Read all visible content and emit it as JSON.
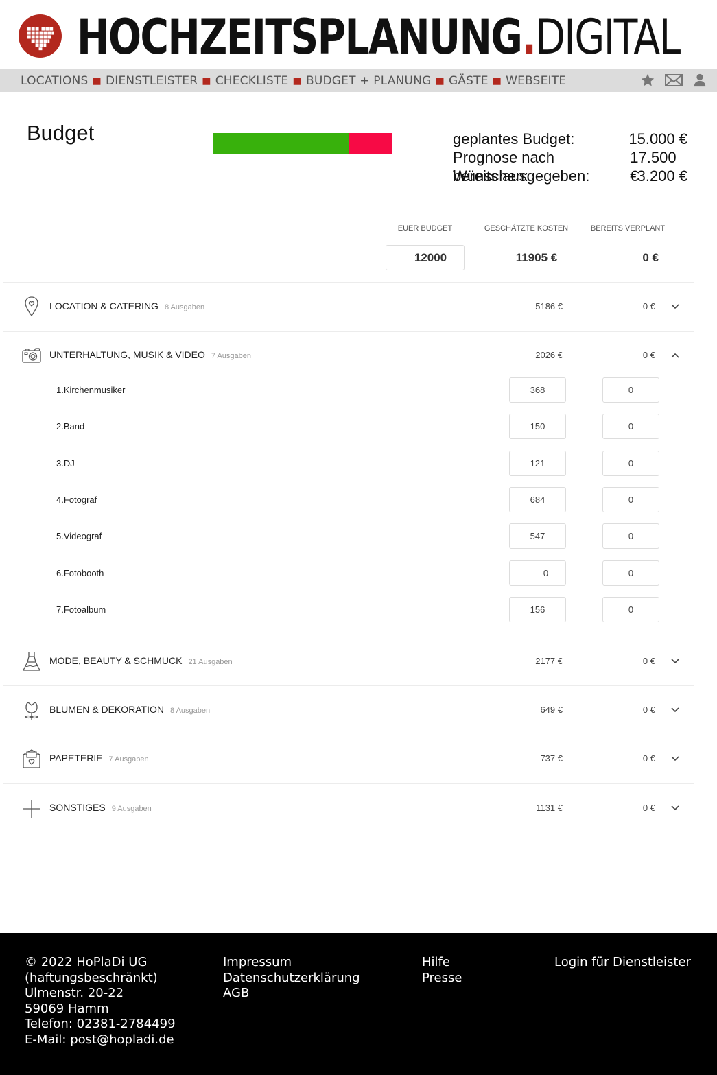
{
  "header": {
    "brand_main": "HOCHZEITSPLANUNG",
    "brand_dot": ".",
    "brand_suffix": "DIGITAL",
    "logo_icon": "pixel-heart-icon",
    "brand_color": "#b3281e"
  },
  "nav": {
    "items": [
      "LOCATIONS",
      "DIENSTLEISTER",
      "CHECKLISTE",
      "BUDGET + PLANUNG",
      "GÄSTE",
      "WEBSEITE"
    ],
    "icons": [
      "star-icon",
      "mail-icon",
      "user-icon"
    ]
  },
  "budget": {
    "title": "Budget",
    "progress": {
      "spent_fraction": 0.76,
      "colors": {
        "ok": "#38b10c",
        "over": "#f70a45"
      }
    },
    "summary": [
      {
        "label": "geplantes Budget:",
        "value": "15.000 €"
      },
      {
        "label": "Prognose nach Wünschen:",
        "value": "17.500 €"
      },
      {
        "label": "bereits ausgegeben:",
        "value": "3.200 €"
      }
    ]
  },
  "table": {
    "col_budget": "EUER BUDGET",
    "col_estimated": "GESCHÄTZTE KOSTEN",
    "col_planned": "BEREITS VERPLANT",
    "budget_value": "12000",
    "total_estimated": "11905 €",
    "total_planned": "0 €"
  },
  "categories": [
    {
      "name": "LOCATION & CATERING",
      "count": "8 Ausgaben",
      "estimated": "5186 €",
      "planned": "0 €",
      "icon": "location-pin-icon",
      "expanded": false
    },
    {
      "name": "UNTERHALTUNG, MUSIK & VIDEO",
      "count": "7 Ausgaben",
      "estimated": "2026 €",
      "planned": "0 €",
      "icon": "camera-icon",
      "expanded": true
    },
    {
      "name": "MODE, BEAUTY & SCHMUCK",
      "count": "21 Ausgaben",
      "estimated": "2177 €",
      "planned": "0 €",
      "icon": "dress-icon",
      "expanded": false
    },
    {
      "name": "BLUMEN & DEKORATION",
      "count": "8 Ausgaben",
      "estimated": "649 €",
      "planned": "0 €",
      "icon": "flower-icon",
      "expanded": false
    },
    {
      "name": "PAPETERIE",
      "count": "7 Ausgaben",
      "estimated": "737 €",
      "planned": "0 €",
      "icon": "envelope-heart-icon",
      "expanded": false
    },
    {
      "name": "SONSTIGES",
      "count": "9 Ausgaben",
      "estimated": "1131 €",
      "planned": "0 €",
      "icon": "plus-icon",
      "expanded": false
    }
  ],
  "expanded_items": [
    {
      "label": "1.Kirchenmusiker",
      "estimated": "368",
      "planned": "0"
    },
    {
      "label": "2.Band",
      "estimated": "150",
      "planned": "0"
    },
    {
      "label": "3.DJ",
      "estimated": "121",
      "planned": "0"
    },
    {
      "label": "4.Fotograf",
      "estimated": "684",
      "planned": "0"
    },
    {
      "label": "5.Videograf",
      "estimated": "547",
      "planned": "0"
    },
    {
      "label": "6.Fotobooth",
      "estimated": "0",
      "planned": "0"
    },
    {
      "label": "7.Fotoalbum",
      "estimated": "156",
      "planned": "0"
    }
  ],
  "footer": {
    "company": [
      "© 2022 HoPlaDi UG",
      "(haftungsbeschränkt)",
      "Ulmenstr. 20-22",
      "59069 Hamm",
      "Telefon: 02381-2784499",
      "E-Mail: post@hopladi.de"
    ],
    "legal": [
      "Impressum",
      "Datenschutzerklärung",
      "AGB"
    ],
    "help": [
      "Hilfe",
      "Presse"
    ],
    "login": "Login für Dienstleister"
  }
}
